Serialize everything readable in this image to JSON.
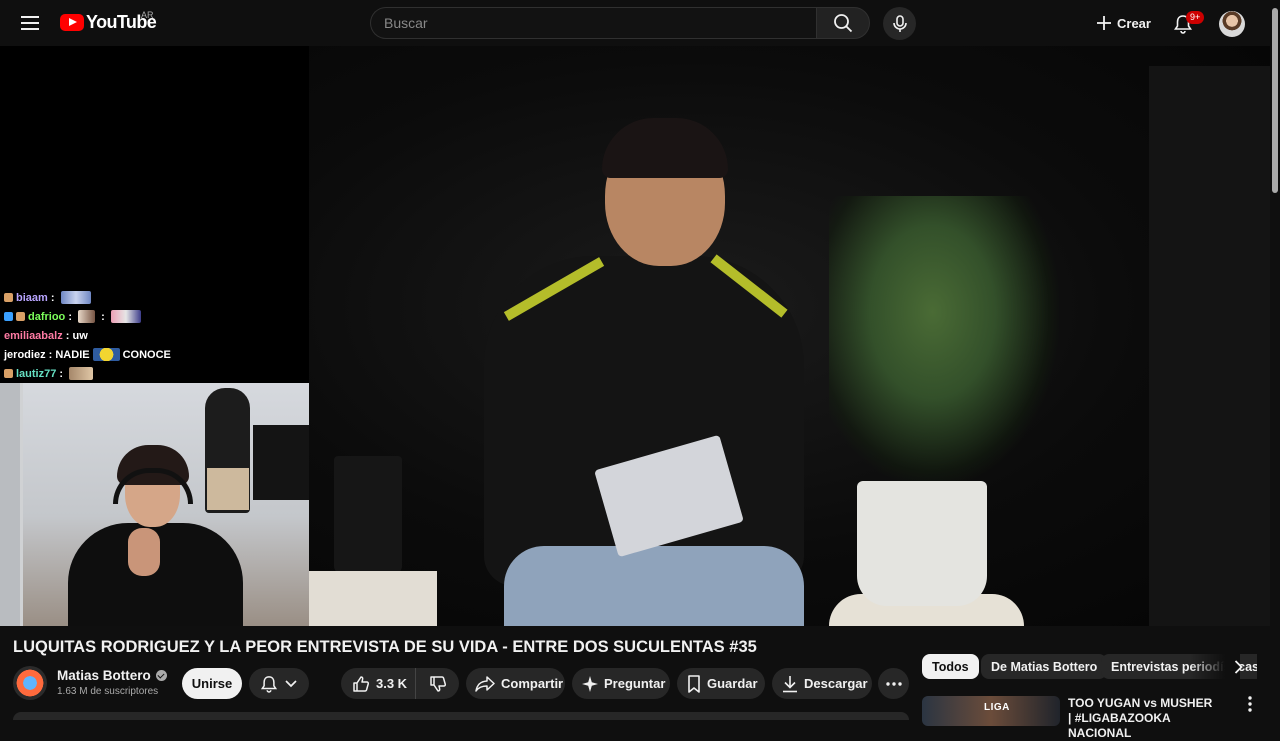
{
  "masthead": {
    "logo_text": "YouTube",
    "country_code": "AR",
    "search_placeholder": "Buscar",
    "create_label": "Crear",
    "notification_count": "9+"
  },
  "player": {
    "chat": [
      {
        "user": "biaam",
        "user_color": "#b9a5ff",
        "message": ""
      },
      {
        "user": "dafrioo",
        "user_color": "#7cff5b",
        "message": ""
      },
      {
        "user": "emiliaabalz",
        "user_color": "#ff7ba4",
        "message": "uw"
      },
      {
        "user": "jerodiez",
        "user_color": "#ffffff",
        "message_before": "NADIE",
        "message_after": "CONOCE"
      },
      {
        "user": "lautiz77",
        "user_color": "#66e0c3",
        "message": ""
      }
    ]
  },
  "video": {
    "title": "LUQUITAS RODRIGUEZ Y LA PEOR ENTREVISTA DE SU VIDA - ENTRE DOS SUCULENTAS #35"
  },
  "channel": {
    "name": "Matias Bottero",
    "subscribers": "1.63 M de suscriptores",
    "join_label": "Unirse"
  },
  "actions": {
    "like_count": "3.3 K",
    "share_label": "Compartir",
    "ask_label": "Preguntar",
    "save_label": "Guardar",
    "download_label": "Descargar"
  },
  "sidebar": {
    "chips": [
      "Todos",
      "De Matias Bottero",
      "Entrevistas periodísticas"
    ],
    "recommended": {
      "thumb_text": "LIGA",
      "title": "TOO YUGAN vs MUSHER | #LIGABAZOOKA NACIONAL"
    }
  },
  "colors": {
    "background": "#0f0f0f",
    "brand_red": "#ff0000",
    "pill_bg": "#272727"
  }
}
